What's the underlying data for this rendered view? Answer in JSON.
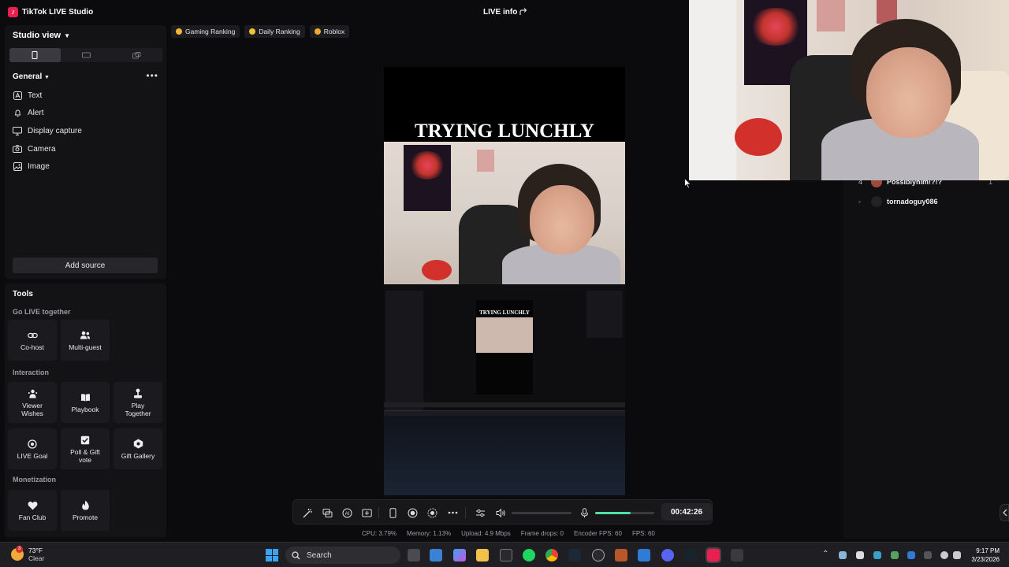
{
  "app": {
    "title": "TikTok LIVE Studio",
    "live_info": "LIVE info"
  },
  "left_panel": {
    "studio_view": "Studio view",
    "general": "General",
    "sources": [
      {
        "label": "Text",
        "icon": "text-icon"
      },
      {
        "label": "Alert",
        "icon": "bell-icon"
      },
      {
        "label": "Display capture",
        "icon": "monitor-icon"
      },
      {
        "label": "Camera",
        "icon": "camera-icon"
      },
      {
        "label": "Image",
        "icon": "image-icon"
      }
    ],
    "add_source": "Add source"
  },
  "tools": {
    "title": "Tools",
    "go_live_together": "Go LIVE together",
    "interaction": "Interaction",
    "monetization": "Monetization",
    "cohost": "Co-host",
    "multiguest": "Multi-guest",
    "viewer_wishes": "Viewer Wishes",
    "playbook": "Playbook",
    "play_together": "Play Together",
    "live_goal": "LIVE Goal",
    "poll_gift": "Poll & Gift vote",
    "gift_gallery": "Gift Gallery",
    "fan_club": "Fan Club",
    "promote": "Promote"
  },
  "ranking_tabs": [
    {
      "label": "Gaming Ranking",
      "color": "#f2b632"
    },
    {
      "label": "Daily Ranking",
      "color": "#f2c232"
    },
    {
      "label": "Roblox",
      "color": "#f0a830"
    }
  ],
  "preview": {
    "overlay_title": "TRYING LUNCHLY"
  },
  "viewers": [
    {
      "rank": "4",
      "name": "Possiblyhim!?!?",
      "score": "1"
    },
    {
      "rank": "-",
      "name": "tornadoguy086"
    }
  ],
  "controls": {
    "timer": "00:42:26",
    "volume_level": 0.6
  },
  "stats": {
    "cpu": "CPU: 3.79%",
    "memory": "Memory: 1.13%",
    "upload": "Upload: 4.9 Mbps",
    "frame_drops": "Frame drops: 0",
    "encoder_fps": "Encoder FPS: 60",
    "fps": "FPS: 60"
  },
  "taskbar": {
    "temp": "73°F",
    "weather": "Clear",
    "weather_badge": "3",
    "search": "Search",
    "time": "9:17 PM",
    "date": "3/23/2026"
  },
  "colors": {
    "accent": "#4fe0a8",
    "tiktok": "#e9204f",
    "panel": "#131316"
  }
}
